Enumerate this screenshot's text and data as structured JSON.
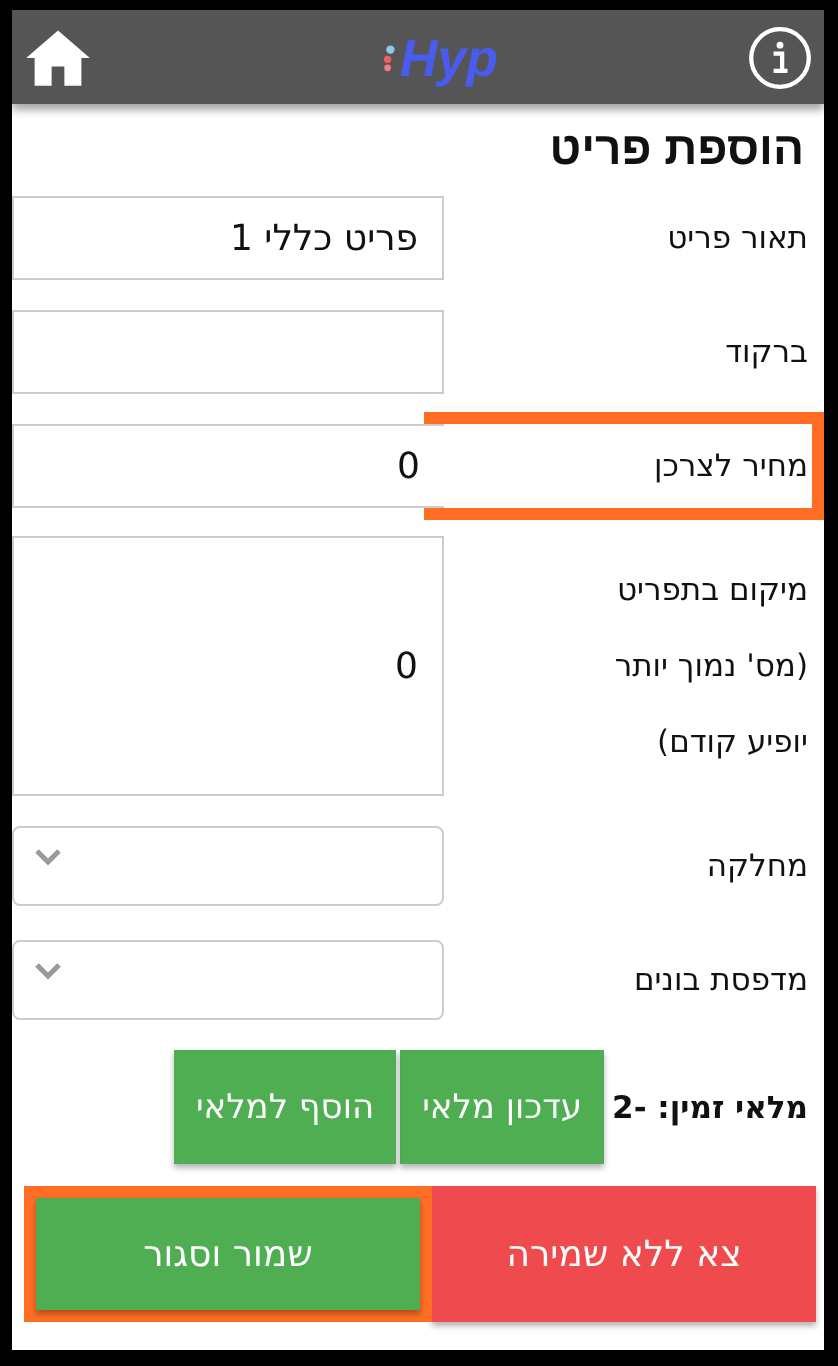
{
  "header": {
    "logo": "Hyp"
  },
  "title": "הוספת פריט",
  "fields": [
    {
      "kind": "text",
      "label": "תאור פריט",
      "value": "פריט כללי 1",
      "highlighted": false
    },
    {
      "kind": "text",
      "label": "ברקוד",
      "highlighted": false
    },
    {
      "kind": "text",
      "label": "מחיר לצרכן",
      "value": "0",
      "highlighted": true
    },
    {
      "kind": "tall",
      "label": "מיקום בתפריט (מס' נמוך יותר יופיע קודם)",
      "value": "0",
      "highlighted": false
    },
    {
      "kind": "select",
      "label": "מחלקה",
      "highlighted": false
    },
    {
      "kind": "select",
      "label": "מדפסת בונים",
      "highlighted": false
    }
  ],
  "stock": {
    "label": "מלאי זמין: -2",
    "buttons": [
      "עדכון מלאי",
      "הוסף למלאי"
    ]
  },
  "footer": [
    {
      "kind": "exit",
      "label": "צא ללא שמירה",
      "highlighted": false
    },
    {
      "kind": "save",
      "label": "שמור וסגור",
      "highlighted": true
    }
  ]
}
